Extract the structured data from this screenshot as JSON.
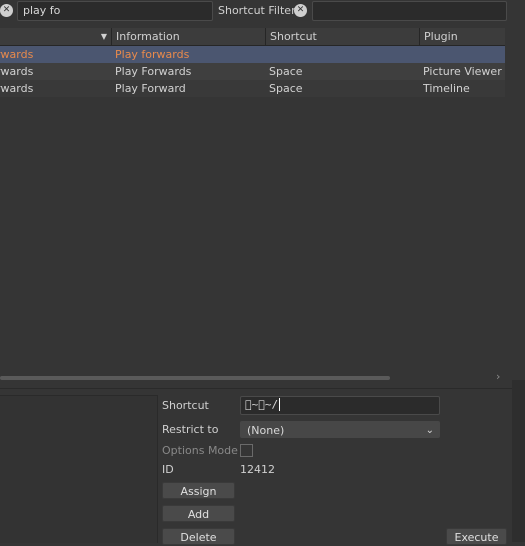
{
  "search": {
    "clear_icon": "close-circle-icon",
    "value": "play fo",
    "shortcut_filter_label": "Shortcut Filter",
    "shortcut_filter_value": ""
  },
  "table": {
    "columns": [
      "",
      "Information",
      "Shortcut",
      "Plugin"
    ],
    "rows": [
      {
        "name": "rwards",
        "info": "Play forwards",
        "shortcut": "",
        "plugin": "",
        "selected": true
      },
      {
        "name": "rwards",
        "info": "Play Forwards",
        "shortcut": "Space",
        "plugin": "Picture Viewer",
        "selected": false
      },
      {
        "name": "rwards",
        "info": "Play Forward",
        "shortcut": "Space",
        "plugin": "Timeline",
        "selected": false
      }
    ]
  },
  "details": {
    "shortcut_label": "Shortcut",
    "shortcut_value": "\u0000~\u0000~/",
    "restrict_label": "Restrict to",
    "restrict_value": "(None)",
    "options_mode_label": "Options Mode",
    "id_label": "ID",
    "id_value": "12412",
    "assign_label": "Assign",
    "add_label": "Add",
    "delete_label": "Delete",
    "execute_label": "Execute"
  },
  "colors": {
    "background": "#353535",
    "selected_row": "#4b5670",
    "selected_text": "#e88a4c"
  }
}
